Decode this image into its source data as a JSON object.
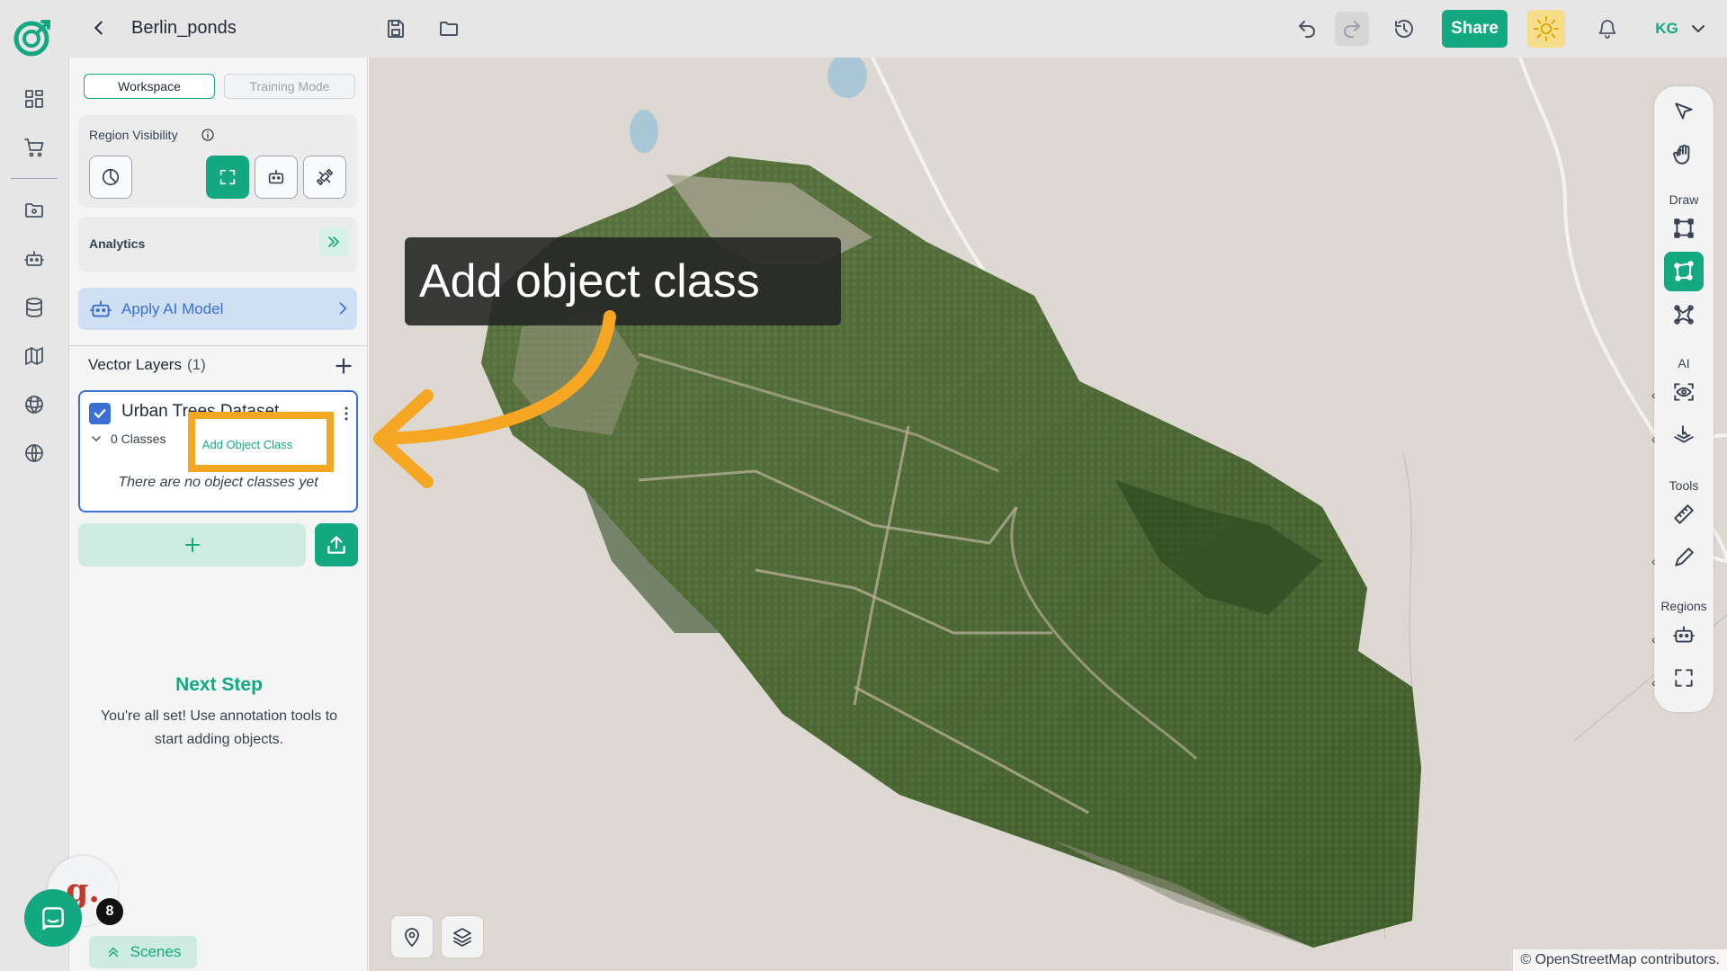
{
  "header": {
    "project_title": "Berlin_ponds",
    "share_label": "Share",
    "avatar_initials": "KG"
  },
  "panel": {
    "mode_tabs": [
      "Workspace",
      "Training Mode"
    ],
    "active_mode": "Workspace",
    "region_visibility_label": "Region Visibility",
    "analytics_label": "Analytics",
    "apply_ai_label": "Apply AI Model",
    "vector_layers_title": "Vector Layers",
    "vector_layers_count": "(1)",
    "layer": {
      "name": "Urban Trees Dataset",
      "checked": true,
      "classes_label": "0 Classes",
      "add_class_label": "Add Object Class",
      "empty_message": "There are no object classes yet"
    },
    "next_step_title": "Next Step",
    "next_step_text": "You're all set! Use annotation tools to start adding objects.",
    "scenes_label": "Scenes"
  },
  "chat": {
    "badge_letter": "g.",
    "notification_count": "8"
  },
  "toolbar": {
    "draw_label": "Draw",
    "ai_label": "AI",
    "tools_label": "Tools",
    "regions_label": "Regions"
  },
  "map": {
    "attribution": "© OpenStreetMap contributors."
  },
  "tutorial": {
    "tooltip_text": "Add object class"
  },
  "colors": {
    "accent": "#13a882",
    "highlight": "#f5a623",
    "blue": "#3b6fd1"
  }
}
